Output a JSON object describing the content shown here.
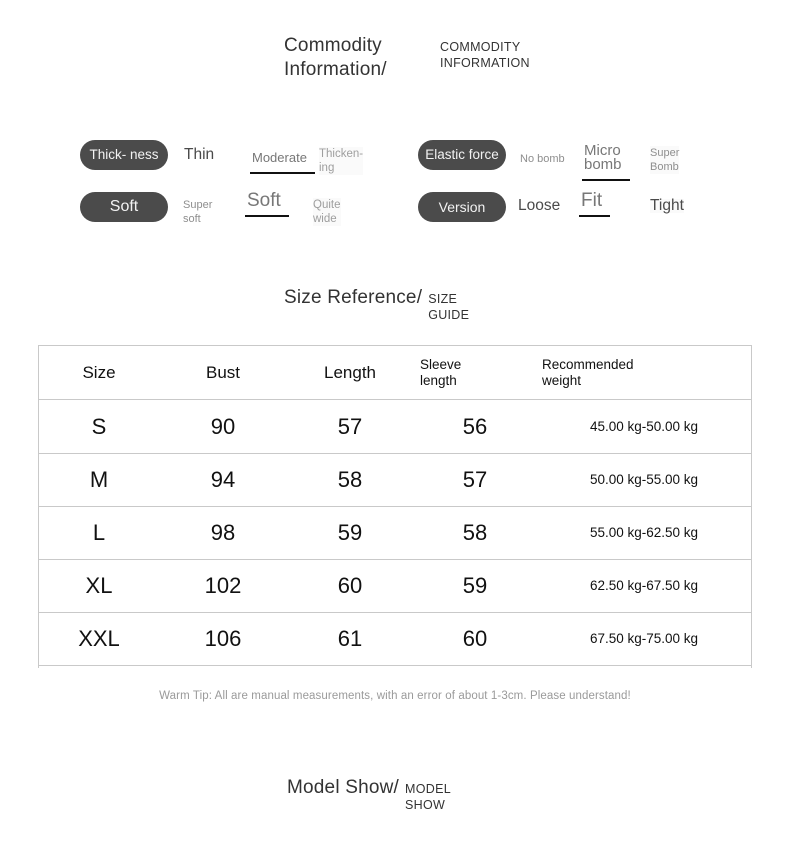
{
  "headings": {
    "commodity": {
      "cn": "Commodity Information/",
      "en": "COMMODITY\nINFORMATION"
    },
    "size": {
      "cn": "Size Reference/",
      "en": "SIZE\nGUIDE"
    },
    "model": {
      "cn": "Model Show/",
      "en": "MODEL\nSHOW"
    }
  },
  "attributes": {
    "left": [
      {
        "pill": "Thick-\nness",
        "options": [
          {
            "label": "Thin",
            "selected": false
          },
          {
            "label": "Moderate",
            "selected": true
          },
          {
            "label": "Thicken-\ning",
            "selected": false
          }
        ]
      },
      {
        "pill": "Soft",
        "options": [
          {
            "label": "Super\nsoft",
            "selected": false
          },
          {
            "label": "Soft",
            "selected": true
          },
          {
            "label": "Quite\nwide",
            "selected": false
          }
        ]
      }
    ],
    "right": [
      {
        "pill": "Elastic\nforce",
        "options": [
          {
            "label": "No bomb",
            "selected": false
          },
          {
            "label": "Micro\nbomb",
            "selected": true
          },
          {
            "label": "Super\nBomb",
            "selected": false
          }
        ]
      },
      {
        "pill": "Version",
        "options": [
          {
            "label": "Loose",
            "selected": false
          },
          {
            "label": "Fit",
            "selected": true
          },
          {
            "label": "Tight",
            "selected": false
          }
        ]
      }
    ]
  },
  "size_table": {
    "columns": [
      "Size",
      "Bust",
      "Length",
      "Sleeve\nlength",
      "Recommended\nweight"
    ],
    "rows": [
      {
        "size": "S",
        "bust": "90",
        "length": "57",
        "sleeve": "56",
        "weight": "45.00 kg-50.00 kg"
      },
      {
        "size": "M",
        "bust": "94",
        "length": "58",
        "sleeve": "57",
        "weight": "50.00 kg-55.00 kg"
      },
      {
        "size": "L",
        "bust": "98",
        "length": "59",
        "sleeve": "58",
        "weight": "55.00 kg-62.50 kg"
      },
      {
        "size": "XL",
        "bust": "102",
        "length": "60",
        "sleeve": "59",
        "weight": "62.50 kg-67.50 kg"
      },
      {
        "size": "XXL",
        "bust": "106",
        "length": "61",
        "sleeve": "60",
        "weight": "67.50 kg-75.00 kg"
      }
    ]
  },
  "warm_tip": "Warm Tip: All are manual measurements, with an error of about 1-3cm. Please understand!",
  "colors": {
    "pill_background": "#4b4b4b",
    "pill_text": "#f2f2f2",
    "selected_underline": "#111111",
    "table_border": "#c9c9c9",
    "muted_text": "#9a9a9a"
  }
}
